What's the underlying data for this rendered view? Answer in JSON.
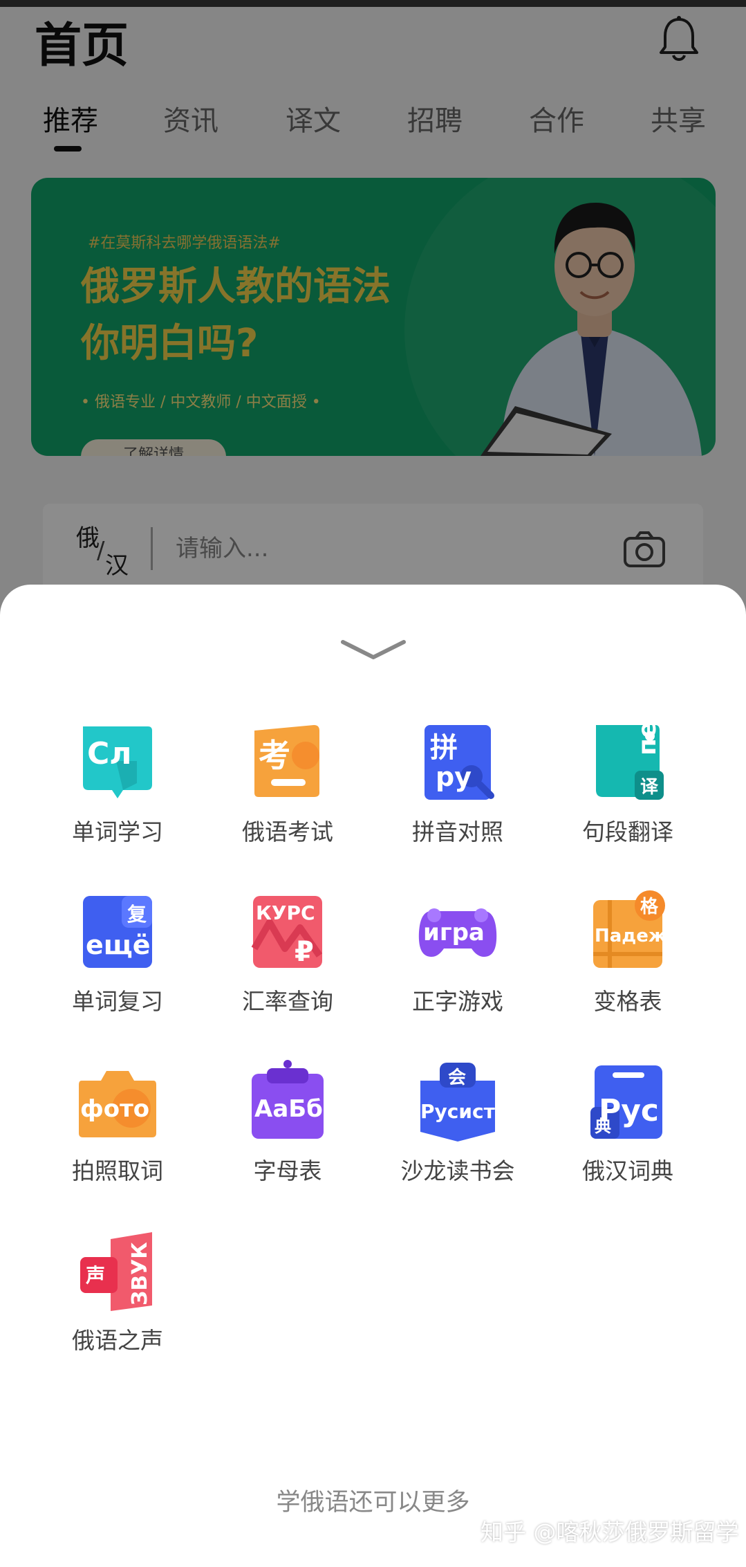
{
  "header": {
    "title": "首页"
  },
  "tabs": [
    {
      "label": "推荐",
      "active": true
    },
    {
      "label": "资讯"
    },
    {
      "label": "译文"
    },
    {
      "label": "招聘"
    },
    {
      "label": "合作"
    },
    {
      "label": "共享"
    }
  ],
  "banner": {
    "tag": "#在莫斯科去哪学俄语语法#",
    "headline_1": "俄罗斯人教的语法",
    "headline_2": "你明白吗?",
    "subtitle": "• 俄语专业 / 中文教师 / 中文面授 •",
    "button": "了解详情",
    "colors": {
      "background": "#11a56a",
      "headline": "#f6d34e"
    }
  },
  "search": {
    "lang_a": "俄",
    "lang_sep": "/",
    "lang_b": "汉",
    "placeholder": "请输入..."
  },
  "tools": [
    {
      "label": "单词学习",
      "icon": "flashcard-icon",
      "color": "#22c7c9"
    },
    {
      "label": "俄语考试",
      "icon": "exam-icon",
      "color": "#f6a23c"
    },
    {
      "label": "拼音对照",
      "icon": "pinyin-icon",
      "color": "#3f5ff0"
    },
    {
      "label": "句段翻译",
      "icon": "translate-icon",
      "color": "#15b8b0"
    },
    {
      "label": "单词复习",
      "icon": "review-icon",
      "color": "#3f5ff0"
    },
    {
      "label": "汇率查询",
      "icon": "exchange-rate-icon",
      "color": "#f15a6c"
    },
    {
      "label": "正字游戏",
      "icon": "gamepad-icon",
      "color": "#8a4ef0"
    },
    {
      "label": "变格表",
      "icon": "declension-table-icon",
      "color": "#f6a23c"
    },
    {
      "label": "拍照取词",
      "icon": "camera-icon",
      "color": "#f6a23c"
    },
    {
      "label": "字母表",
      "icon": "alphabet-icon",
      "color": "#8a4ef0"
    },
    {
      "label": "沙龙读书会",
      "icon": "book-club-icon",
      "color": "#3f5ff0"
    },
    {
      "label": "俄汉词典",
      "icon": "dictionary-icon",
      "color": "#3f5ff0"
    },
    {
      "label": "俄语之声",
      "icon": "audio-icon",
      "color": "#f15a6c"
    }
  ],
  "icon_text": {
    "flashcard": "Сл",
    "exam": "考",
    "pinyin_top": "拼",
    "pinyin_bottom": "py",
    "translate_main": "пере",
    "translate_badge": "译",
    "review_badge": "复",
    "review_main": "ещё",
    "exchange": "КУРС",
    "exchange_symbol": "₽",
    "game": "игра",
    "declension_badge": "格",
    "declension_main": "Падеж",
    "camera": "фото",
    "alphabet": "АаБб",
    "club_badge": "会",
    "club_main": "Русист",
    "dict_main": "Рус",
    "dict_badge": "典",
    "audio_badge": "声",
    "audio_main": "ЗВУК"
  },
  "footer": {
    "more": "学俄语还可以更多"
  },
  "watermark": "知乎 @喀秋莎俄罗斯留学"
}
